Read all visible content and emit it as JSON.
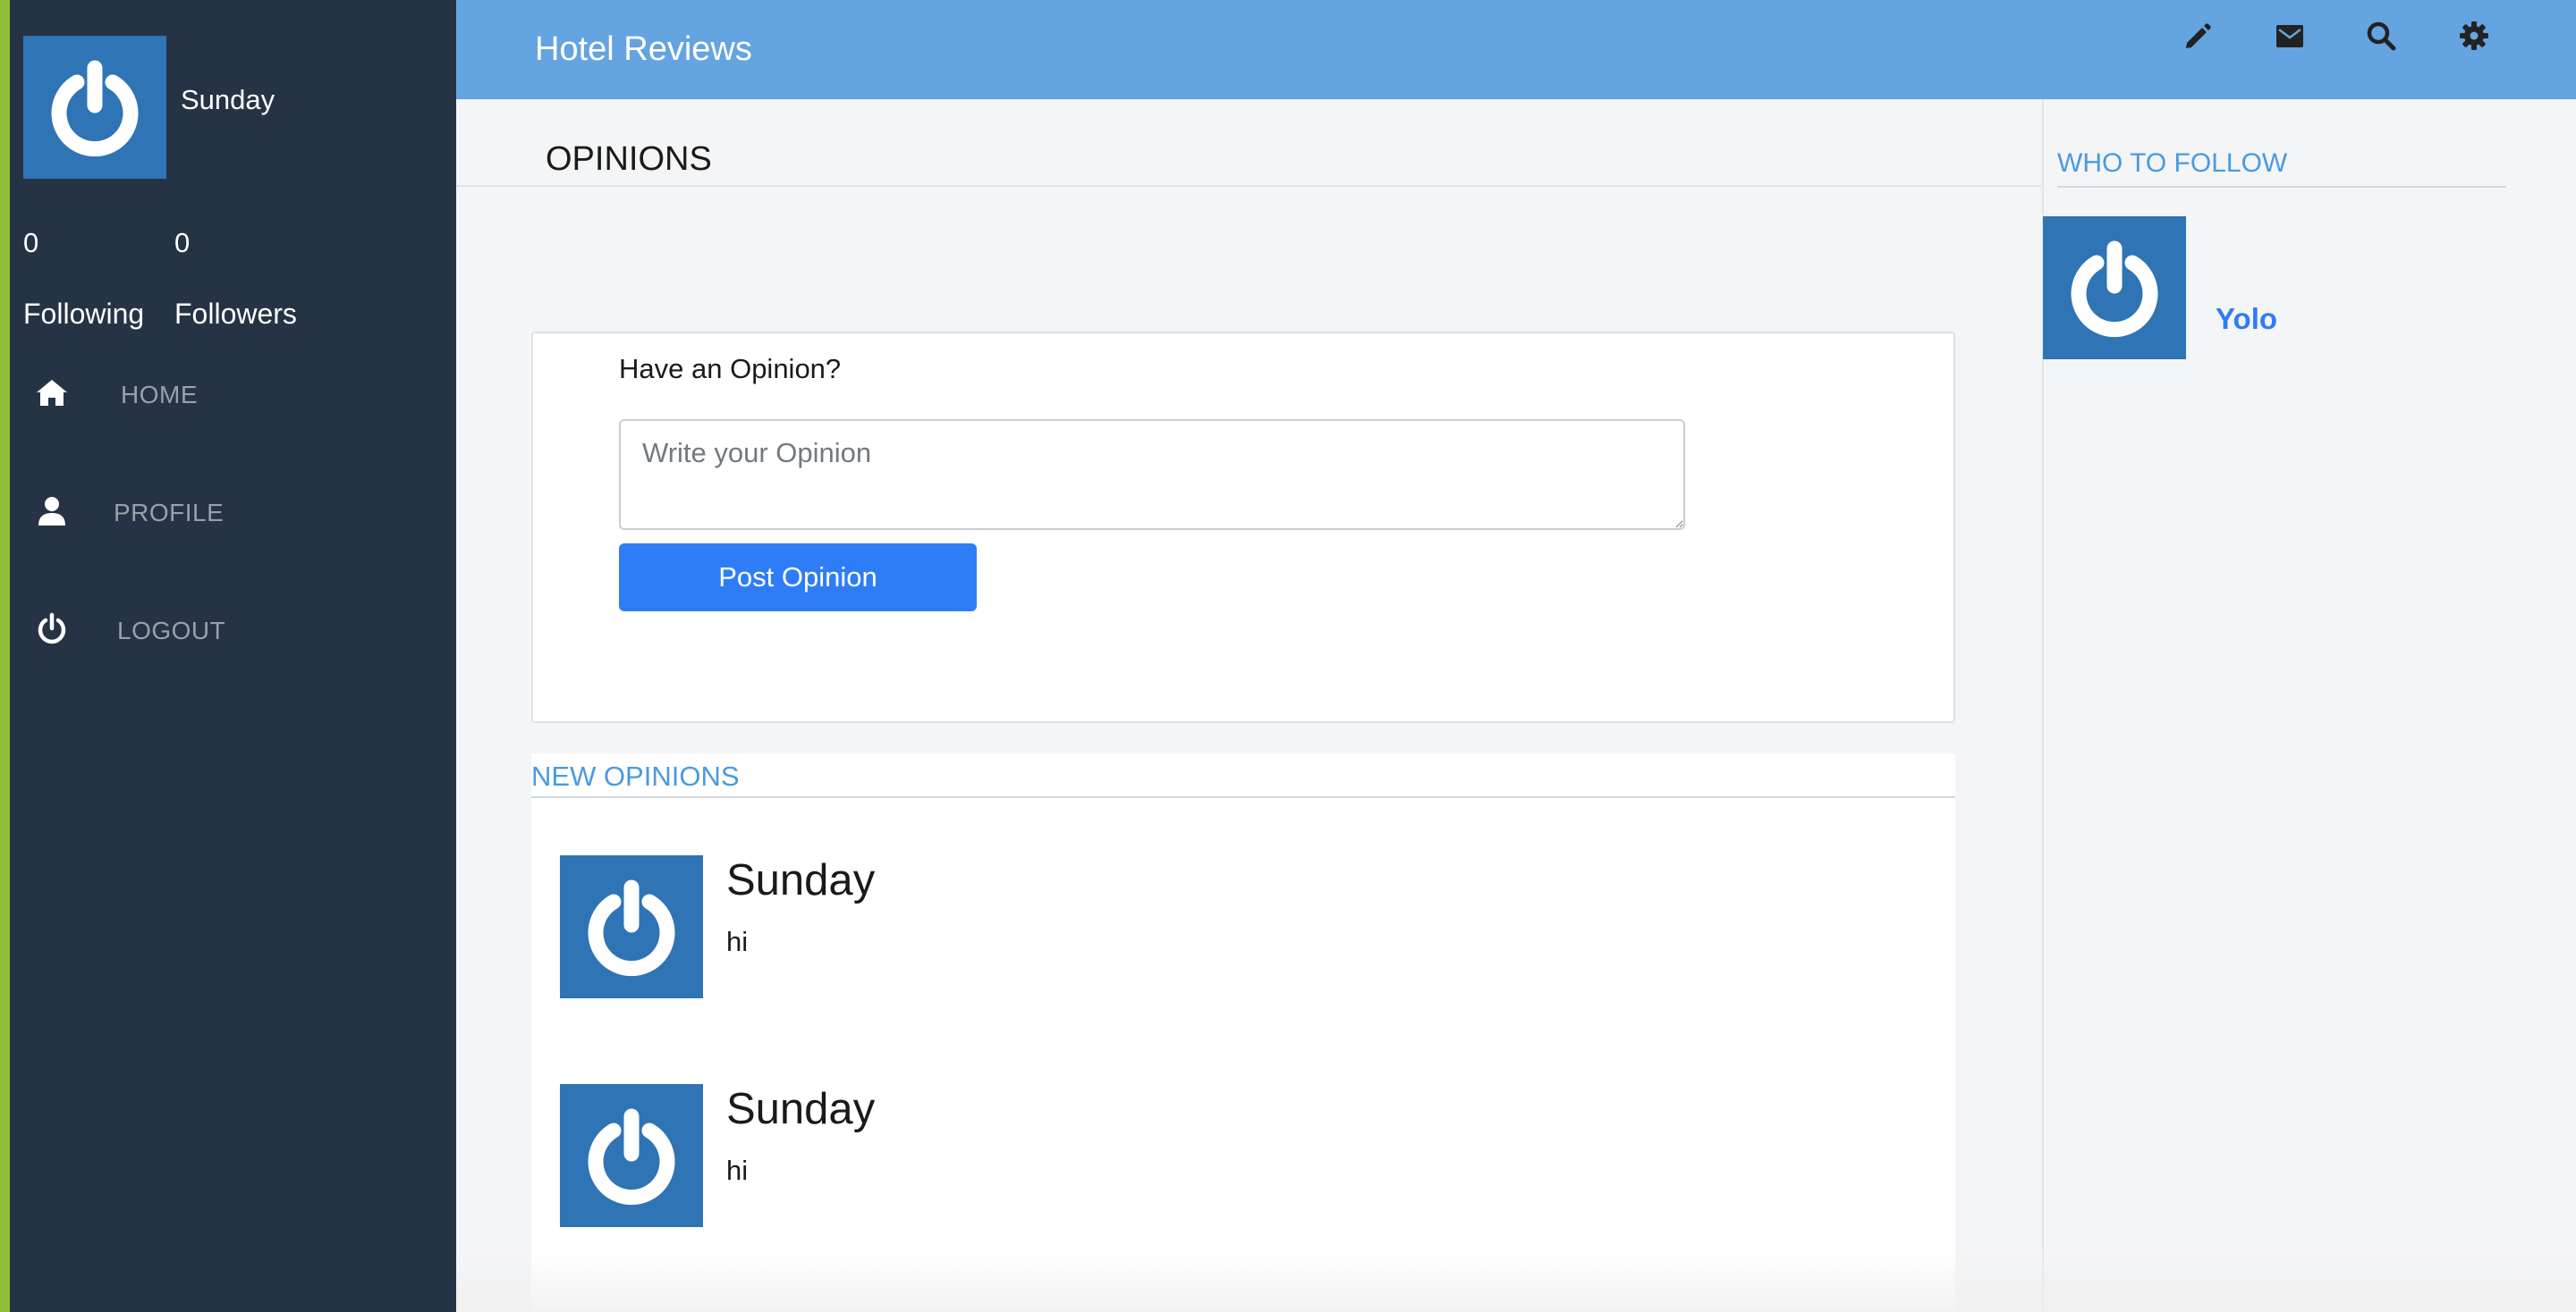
{
  "app": {
    "title": "Hotel Reviews"
  },
  "colors": {
    "sidebar_bg": "#253345",
    "topbar_bg": "#64a4e0",
    "primary_button": "#2f7df6",
    "section_header": "#4a9ae0",
    "avatar_bg": "#2f74b5",
    "window_border": "#8fbf3a"
  },
  "sidebar": {
    "avatar_icon": "power-logo",
    "username": "Sunday",
    "stats": {
      "following_count": "0",
      "followers_count": "0",
      "following_label": "Following",
      "followers_label": "Followers"
    },
    "nav": [
      {
        "label": "HOME",
        "icon": "home-icon"
      },
      {
        "label": "PROFILE",
        "icon": "user-icon"
      },
      {
        "label": "LOGOUT",
        "icon": "power-icon"
      }
    ]
  },
  "topbar": {
    "icons": [
      "pencil-icon",
      "envelope-icon",
      "search-icon",
      "gear-icon"
    ]
  },
  "main": {
    "page_title": "OPINIONS",
    "composer": {
      "prompt": "Have an Opinion?",
      "placeholder": "Write your Opinion",
      "value": "",
      "button_label": "Post Opinion"
    },
    "feed": {
      "header": "NEW OPINIONS",
      "items": [
        {
          "author": "Sunday",
          "text": "hi"
        },
        {
          "author": "Sunday",
          "text": "hi"
        }
      ]
    }
  },
  "who_to_follow": {
    "header": "WHO TO FOLLOW",
    "users": [
      {
        "name": "Yolo"
      }
    ]
  }
}
